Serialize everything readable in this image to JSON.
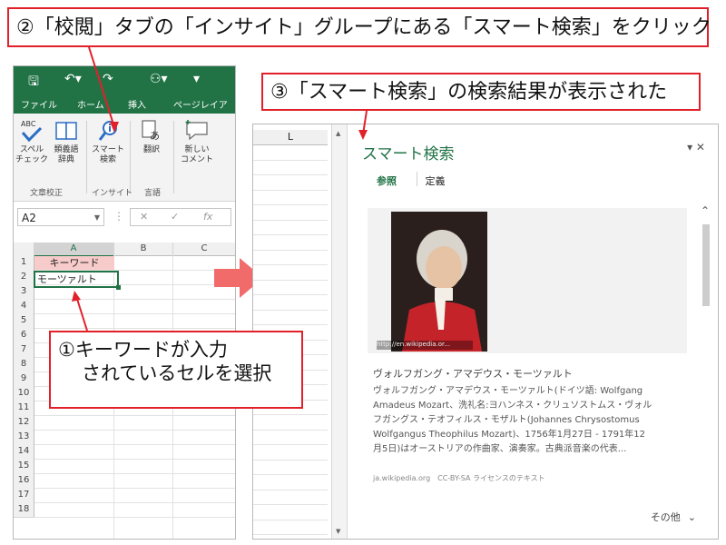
{
  "callouts": {
    "step2": "②「校閲」タブの「インサイト」グループにある「スマート検索」をクリック",
    "step3": "③「スマート検索」の検索結果が表示された",
    "step1_line1": "①キーワードが入力",
    "step1_line2": "されているセルを選択"
  },
  "excel": {
    "title_icons": [
      "save-icon",
      "undo-icon",
      "redo-icon",
      "user-icon",
      "more-icon"
    ],
    "tabs": [
      "ファイル",
      "ホーム",
      "挿入",
      "ページレイアウ"
    ],
    "ribbon_buttons": {
      "spell_l1": "スペル",
      "spell_l2": "チェック",
      "thesaurus_l1": "類義語",
      "thesaurus_l2": "辞典",
      "smart_l1": "スマート",
      "smart_l2": "検索",
      "translate": "翻訳",
      "comment_l1": "新しい",
      "comment_l2": "コメント",
      "abc": "ABC",
      "a_glyph": "あ"
    },
    "groups": {
      "proofing": "文章校正",
      "insights": "インサイト",
      "language": "言語"
    },
    "namebox": "A2",
    "formula_icons": {
      "more": "⋮",
      "cancel": "✕",
      "enter": "✓",
      "fx": "fx"
    },
    "columns": [
      "A",
      "B",
      "C"
    ],
    "rows": [
      "1",
      "2",
      "3",
      "4",
      "5",
      "6",
      "7",
      "8",
      "9",
      "10",
      "11",
      "12",
      "13",
      "14",
      "15",
      "16",
      "17",
      "18"
    ],
    "cells": {
      "A1": "キーワード",
      "A2": "モーツァルト"
    }
  },
  "pane": {
    "column_letter": "L",
    "title": "スマート検索",
    "controls": "▾ ✕",
    "tabs": [
      "参照",
      "定義"
    ],
    "image_caption": "http://en.wikipedia.or...",
    "result_name": "ヴォルフガング・アマデウス・モーツァルト",
    "result_body": "ヴォルフガング・アマデウス・モーツァルト(ドイツ語: Wolfgang\nAmadeus Mozart、洗礼名:ヨハンネス・クリュソストムス・ヴォル\nフガングス・テオフィルス・モザルト(Johannes Chrysostomus\nWolfgangus Theophilus Mozart)、1756年1月27日 - 1791年12\n月5日)はオーストリアの作曲家、演奏家。古典派音楽の代表...",
    "result_source": "ja.wikipedia.org　CC-BY-SA ライセンスのテキスト",
    "more": "その他"
  },
  "colors": {
    "excel_green": "#217346",
    "callout_red": "#e2202a",
    "highlight": "#f8cbcb"
  }
}
